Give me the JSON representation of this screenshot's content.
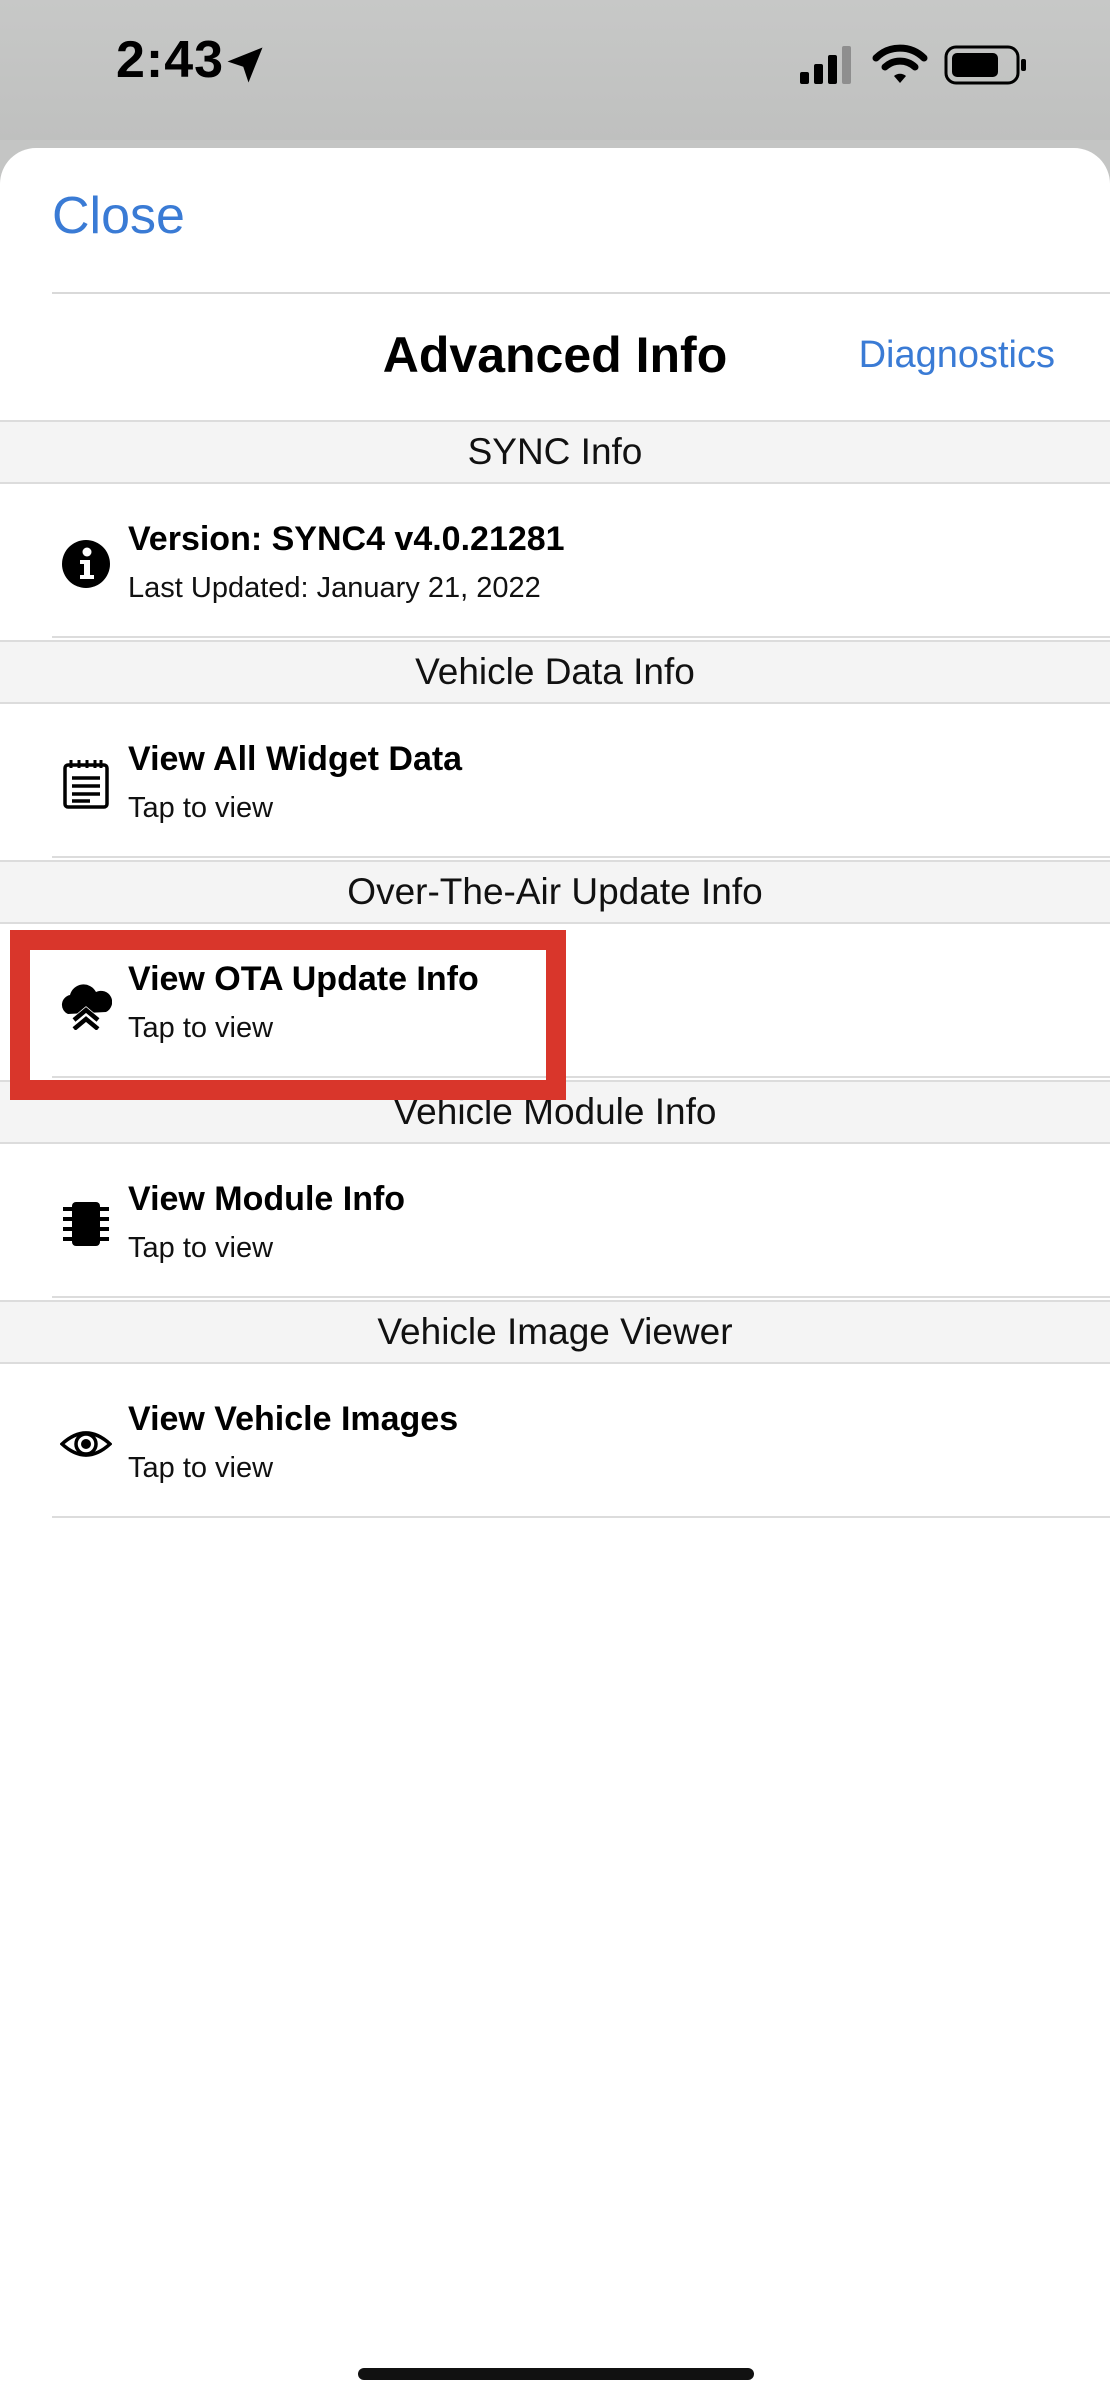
{
  "status_bar": {
    "time": "2:43",
    "icons": [
      "location-arrow-icon",
      "cellular-signal-icon",
      "wifi-icon",
      "battery-icon"
    ]
  },
  "header": {
    "close_label": "Close",
    "title": "Advanced Info",
    "diagnostics_label": "Diagnostics"
  },
  "sections": [
    {
      "header": "SYNC Info",
      "item": {
        "icon": "info-icon",
        "title": "Version: SYNC4 v4.0.21281",
        "subtitle": "Last Updated: January 21, 2022"
      }
    },
    {
      "header": "Vehicle Data Info",
      "item": {
        "icon": "notepad-icon",
        "title": "View All Widget Data",
        "subtitle": "Tap to view"
      }
    },
    {
      "header": "Over-The-Air Update Info",
      "item": {
        "icon": "cloud-upload-icon",
        "title": "View OTA Update Info",
        "subtitle": "Tap to view"
      }
    },
    {
      "header": "Vehicle Module Info",
      "item": {
        "icon": "chip-icon",
        "title": "View Module Info",
        "subtitle": "Tap to view"
      }
    },
    {
      "header": "Vehicle Image Viewer",
      "item": {
        "icon": "eye-icon",
        "title": "View Vehicle Images",
        "subtitle": "Tap to view"
      }
    }
  ],
  "colors": {
    "accent": "#3a7bd5",
    "highlight": "#d9362b",
    "section_bg": "#f4f4f4",
    "status_bar_bg": "#c4c5c4"
  }
}
